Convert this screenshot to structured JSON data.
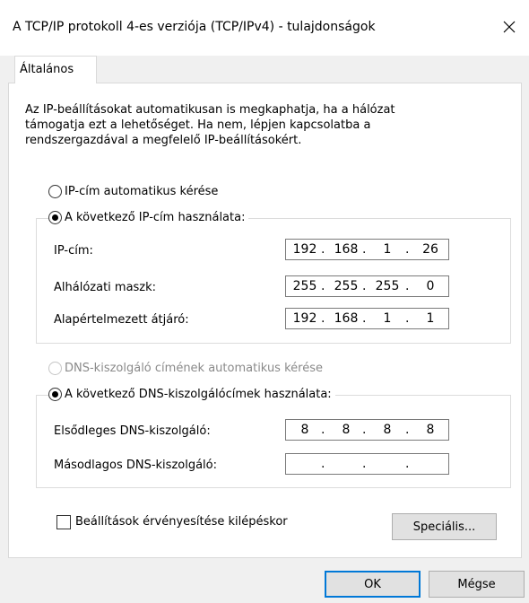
{
  "window": {
    "title": "A TCP/IP protokoll 4-es verziója (TCP/IPv4) - tulajdonságok",
    "close_glyph": "✕"
  },
  "tab": {
    "label": "Általános"
  },
  "description": [
    "Az IP-beállításokat automatikusan is megkaphatja, ha a hálózat",
    "támogatja ezt a lehetőséget. Ha nem, lépjen kapcsolatba a",
    "rendszergazdával a megfelelő IP-beállításokért."
  ],
  "ip": {
    "auto_label": "IP-cím automatikus kérése",
    "manual_label": "A következő IP-cím használata:",
    "selected": "manual",
    "fields": [
      {
        "label": "IP-cím:",
        "octets": [
          "192",
          "168",
          "1",
          "26"
        ]
      },
      {
        "label": "Alhálózati maszk:",
        "octets": [
          "255",
          "255",
          "255",
          "0"
        ]
      },
      {
        "label": "Alapértelmezett átjáró:",
        "octets": [
          "192",
          "168",
          "1",
          "1"
        ]
      }
    ]
  },
  "dns": {
    "auto_label": "DNS-kiszolgáló címének automatikus kérése",
    "auto_disabled": true,
    "manual_label": "A következő DNS-kiszolgálócímek használata:",
    "selected": "manual",
    "fields": [
      {
        "label": "Elsődleges DNS-kiszolgáló:",
        "octets": [
          "8",
          "8",
          "8",
          "8"
        ]
      },
      {
        "label": "Másodlagos DNS-kiszolgáló:",
        "octets": [
          "",
          "",
          "",
          ""
        ]
      }
    ]
  },
  "validate": {
    "label": "Beállítások érvényesítése kilépéskor",
    "checked": false
  },
  "buttons": {
    "advanced": "Speciális...",
    "ok": "OK",
    "cancel": "Mégse"
  },
  "colors": {
    "focus_border": "#0078d7",
    "disabled_text": "#8a8a8a"
  }
}
